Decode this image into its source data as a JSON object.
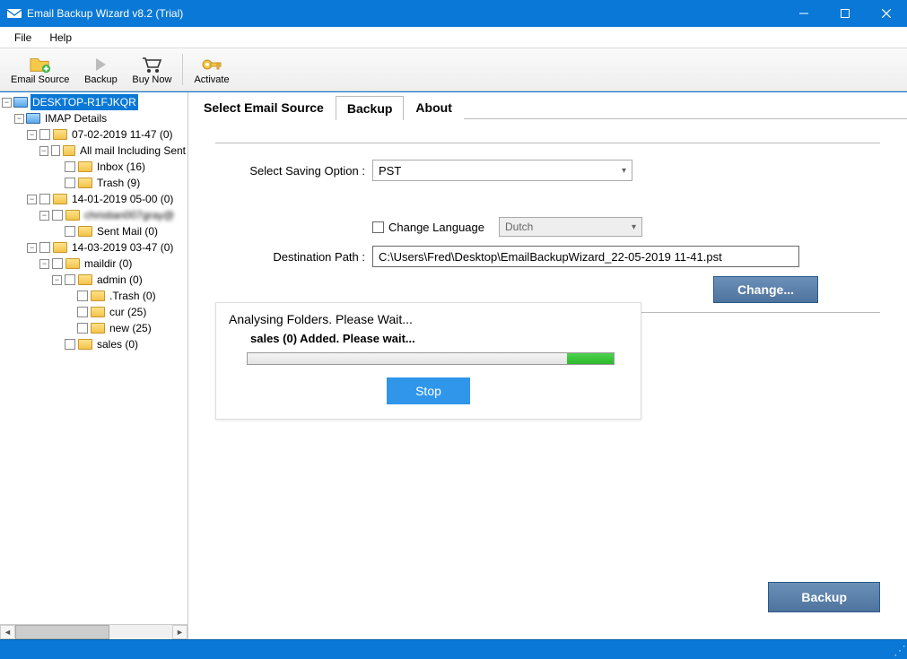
{
  "window": {
    "title": "Email Backup Wizard v8.2 (Trial)"
  },
  "menubar": {
    "file": "File",
    "help": "Help"
  },
  "toolbar": {
    "email_source": "Email Source",
    "backup": "Backup",
    "buy_now": "Buy Now",
    "activate": "Activate"
  },
  "tree": {
    "root": "DESKTOP-R1FJKQR",
    "imap": "IMAP Details",
    "n070219": "07-02-2019 11-47 (0)",
    "all_mail": "All mail Including Sent",
    "inbox": "Inbox (16)",
    "trash1": "Trash (9)",
    "n140119": "14-01-2019 05-00 (0)",
    "obscured": "christian007gray@",
    "sent_mail": "Sent Mail (0)",
    "n140319": "14-03-2019 03-47 (0)",
    "maildir": "maildir (0)",
    "admin": "admin (0)",
    "trash2": ".Trash (0)",
    "cur": "cur (25)",
    "new": "new (25)",
    "sales": "sales (0)"
  },
  "tabs": {
    "select_source": "Select Email Source",
    "backup": "Backup",
    "about": "About"
  },
  "form": {
    "saving_option_label": "Select Saving Option  :",
    "saving_option_value": "PST",
    "change_language_label": "Change Language",
    "language_value": "Dutch",
    "destination_label": "Destination Path  :",
    "destination_value": "C:\\Users\\Fred\\Desktop\\EmailBackupWizard_22-05-2019 11-41.pst",
    "change_btn": "Change..."
  },
  "progress": {
    "title": "Analysing Folders. Please Wait...",
    "subtitle": "sales (0) Added. Please wait...",
    "stop_btn": "Stop"
  },
  "actions": {
    "backup_btn": "Backup"
  }
}
